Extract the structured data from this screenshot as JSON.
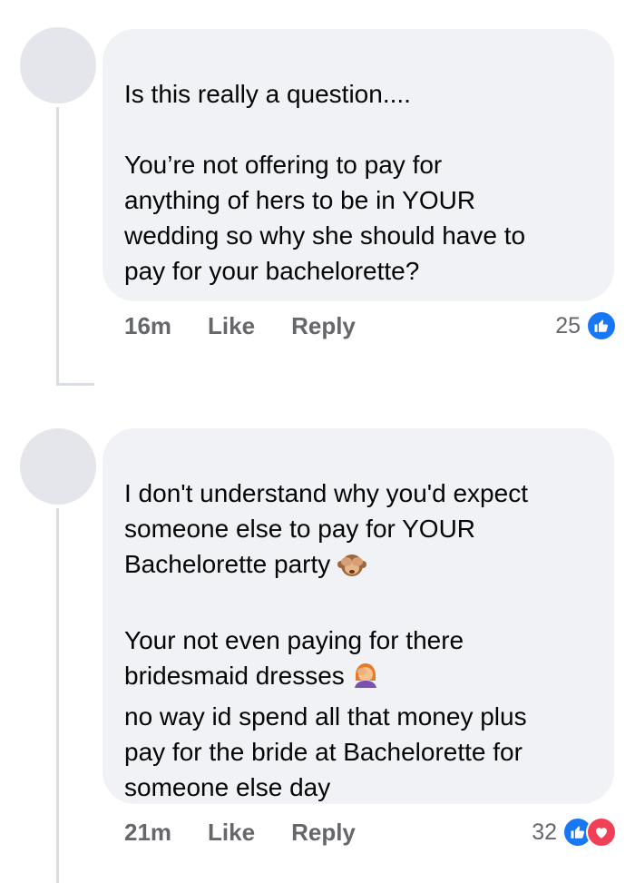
{
  "comments": [
    {
      "paragraphs": [
        "Is this really a question....",
        "You’re not offering to pay for\nanything of hers to be in YOUR\nwedding so why she should have to\npay for your bachelorette?"
      ],
      "time": "16m",
      "like_label": "Like",
      "reply_label": "Reply",
      "reaction_count": "25",
      "reactions": [
        "like-icon"
      ]
    },
    {
      "paragraphs": [
        "I don't understand why you'd expect\nsomeone else to pay for YOUR\nBachelorette party",
        "Your not even paying for there\nbridesmaid dresses",
        "no way id spend all that money plus\npay for the bride at Bachelorette for\nsomeone else day"
      ],
      "emoji_1": "see-no-evil-monkey-emoji",
      "emoji_2": "woman-facepalming-emoji",
      "time": "21m",
      "like_label": "Like",
      "reply_label": "Reply",
      "reaction_count": "32",
      "reactions": [
        "like-icon",
        "love-icon"
      ]
    }
  ],
  "colors": {
    "bubble": "#f0f2f5",
    "avatar": "#e4e6eb",
    "meta_text": "#65676b",
    "like_blue": "#1877f2",
    "love_red": "#f33e58"
  }
}
